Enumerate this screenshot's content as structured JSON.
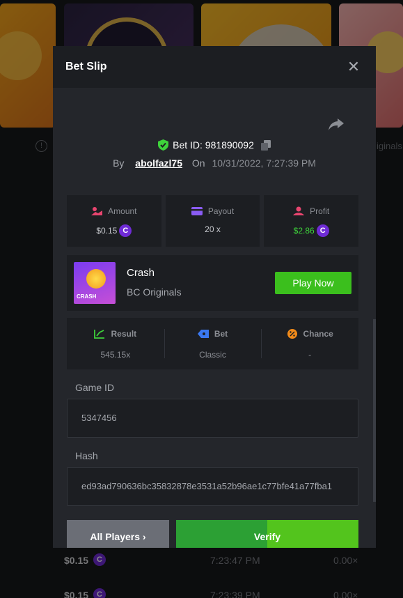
{
  "background": {
    "originals_label": "iginals",
    "info_symbol": "!",
    "rows": [
      {
        "amount": "$0.15",
        "time": "7:23:47 PM",
        "multiplier": "0.00×"
      },
      {
        "amount": "$0.15",
        "time": "7:23:39 PM",
        "multiplier": "0.00×"
      }
    ]
  },
  "modal": {
    "title": "Bet Slip",
    "close_symbol": "✕",
    "bet_id_label": "Bet ID: 981890092",
    "by_label": "By",
    "username": "abolfazl75",
    "on_label": "On",
    "date": "10/31/2022, 7:27:39 PM",
    "stats": {
      "amount_label": "Amount",
      "amount_value": "$0.15",
      "payout_label": "Payout",
      "payout_value": "20 x",
      "profit_label": "Profit",
      "profit_value": "$2.86"
    },
    "coin_symbol": "C",
    "game": {
      "name": "Crash",
      "provider": "BC Originals",
      "thumb_label": "CRASH",
      "play_label": "Play Now"
    },
    "details": {
      "result_label": "Result",
      "result_value": "545.15x",
      "bet_label": "Bet",
      "bet_value": "Classic",
      "chance_label": "Chance",
      "chance_value": "-"
    },
    "game_id_label": "Game ID",
    "game_id_value": "5347456",
    "hash_label": "Hash",
    "hash_value": "ed93ad790636bc35832878e3531a52b96ae1c77bfe41a77fba1",
    "all_players_label": "All Players ›",
    "verify_label": "Verify"
  },
  "colors": {
    "green": "#3ed33b",
    "coin_purple": "#6f2bd6",
    "play_green": "#3bbf1d"
  }
}
